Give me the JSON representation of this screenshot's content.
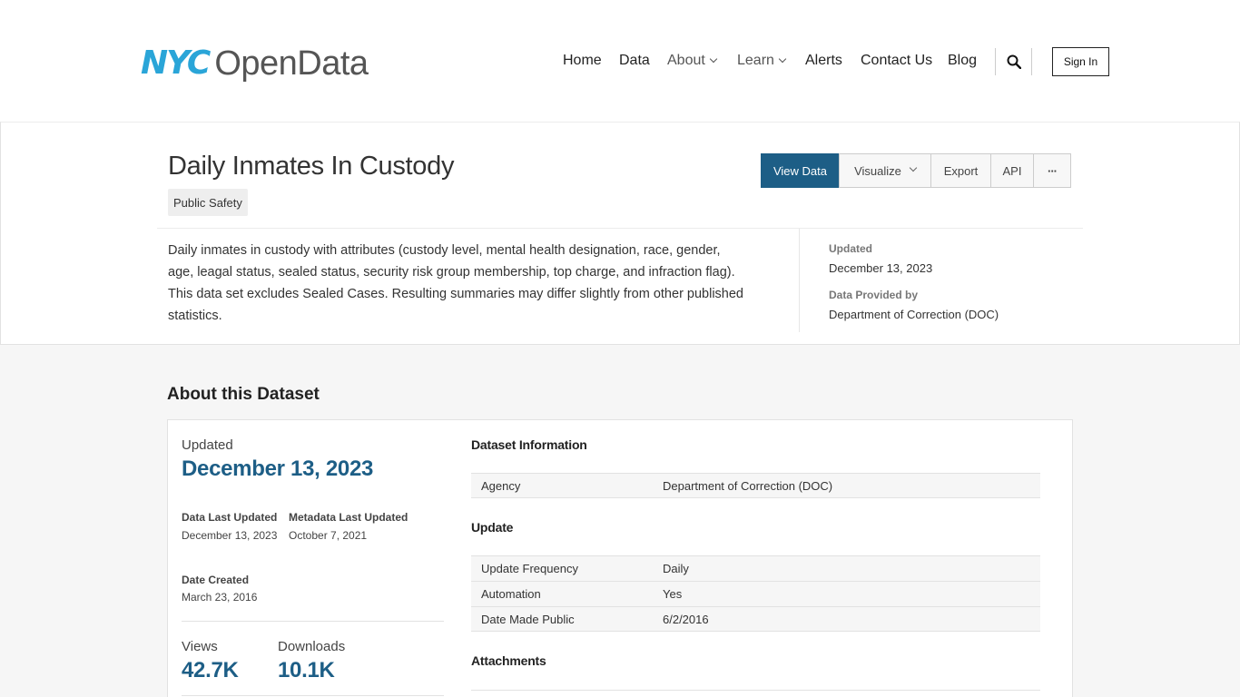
{
  "header": {
    "logo_nyc": "NYC",
    "logo_open": "OpenData",
    "nav": [
      {
        "label": "Home",
        "dropdown": false
      },
      {
        "label": "Data",
        "dropdown": false
      },
      {
        "label": "About",
        "dropdown": true
      },
      {
        "label": "Learn",
        "dropdown": true
      },
      {
        "label": "Alerts",
        "dropdown": false
      },
      {
        "label": "Contact Us",
        "dropdown": false
      },
      {
        "label": "Blog",
        "dropdown": false
      }
    ],
    "search_icon": "search-icon",
    "sign_in": "Sign In"
  },
  "dataset": {
    "title": "Daily Inmates In Custody",
    "category": "Public Safety",
    "actions": {
      "view_data": "View Data",
      "visualize": "Visualize",
      "export": "Export",
      "api": "API",
      "more": "···"
    },
    "description": "Daily inmates in custody with attributes (custody level, mental health designation, race, gender, age, leagal status, sealed status, security risk group membership, top charge, and infraction flag). This data set excludes Sealed Cases. Resulting summaries may differ slightly from other published statistics.",
    "meta": {
      "updated_label": "Updated",
      "updated_value": "December 13, 2023",
      "provided_label": "Data Provided by",
      "provided_value": "Department of Correction (DOC)"
    }
  },
  "about": {
    "heading": "About this Dataset",
    "updated_label": "Updated",
    "updated_value": "December 13, 2023",
    "data_last_updated_label": "Data Last Updated",
    "data_last_updated_value": "December 13, 2023",
    "metadata_last_updated_label": "Metadata Last Updated",
    "metadata_last_updated_value": "October 7, 2021",
    "date_created_label": "Date Created",
    "date_created_value": "March 23, 2016",
    "views_label": "Views",
    "views_value": "42.7K",
    "downloads_label": "Downloads",
    "downloads_value": "10.1K",
    "sections": {
      "dataset_information": "Dataset Information",
      "update": "Update",
      "attachments": "Attachments"
    },
    "info_rows": [
      {
        "key": "Agency",
        "value": "Department of Correction (DOC)"
      }
    ],
    "update_rows": [
      {
        "key": "Update Frequency",
        "value": "Daily"
      },
      {
        "key": "Automation",
        "value": "Yes"
      },
      {
        "key": "Date Made Public",
        "value": "6/2/2016"
      }
    ]
  },
  "colors": {
    "brand_blue": "#1d5e86",
    "logo_blue": "#2aa5d8"
  }
}
